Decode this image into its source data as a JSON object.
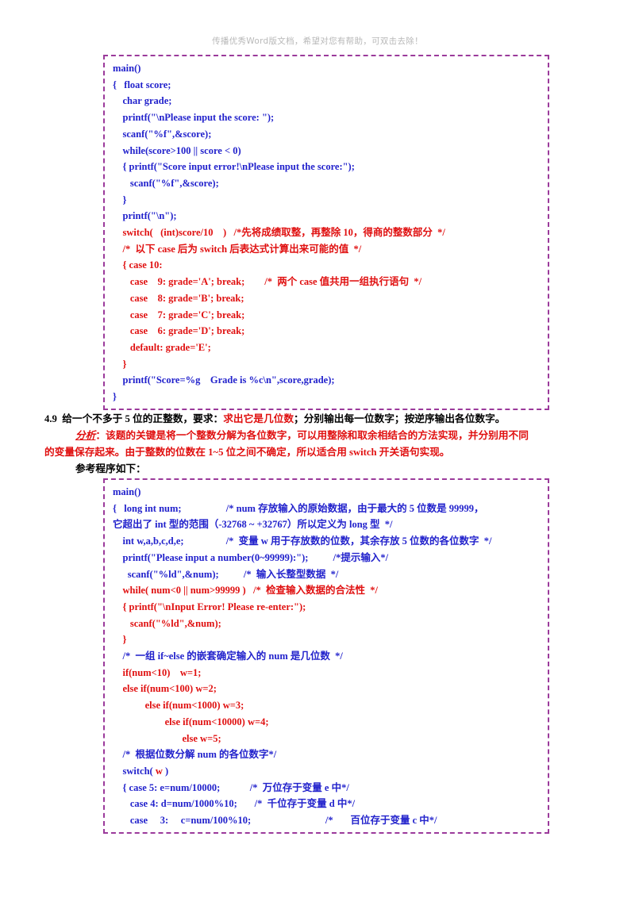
{
  "header": {
    "watermark": "传播优秀Word版文档，希望对您有帮助，可双击去除！"
  },
  "code_block_1": {
    "lines": [
      {
        "text": "main()",
        "color": "blue"
      },
      {
        "text": "{   float score;",
        "color": "blue"
      },
      {
        "text": "    char grade;",
        "color": "blue"
      },
      {
        "text": "    printf(\"\\nPlease input the score: \");",
        "color": "blue"
      },
      {
        "text": "    scanf(\"%f\",&score);",
        "color": "blue"
      },
      {
        "text": "    while(score>100 || score < 0)",
        "color": "blue"
      },
      {
        "text": "    { printf(\"Score input error!\\nPlease input the score:\");",
        "color": "blue"
      },
      {
        "text": "       scanf(\"%f\",&score);",
        "color": "blue"
      },
      {
        "text": "    }",
        "color": "blue"
      },
      {
        "text": "    printf(\"\\n\");",
        "color": "blue"
      },
      {
        "text": "    switch(   (int)score/10    )   /*先将成绩取整，再整除 10，得商的整数部分  */",
        "color": "red"
      },
      {
        "text": "    /*  以下 case 后为 switch 后表达式计算出来可能的值  */",
        "color": "red"
      },
      {
        "text": "    { case 10:",
        "color": "red"
      },
      {
        "text": "       case    9: grade='A'; break;        /*  两个 case 值共用一组执行语句  */",
        "color": "red"
      },
      {
        "text": "       case    8: grade='B'; break;",
        "color": "red"
      },
      {
        "text": "       case    7: grade='C'; break;",
        "color": "red"
      },
      {
        "text": "       case    6: grade='D'; break;",
        "color": "red"
      },
      {
        "text": "       default: grade='E';",
        "color": "red"
      },
      {
        "text": "    }",
        "color": "red"
      },
      {
        "text": "    printf(\"Score=%g    Grade is %c\\n\",score,grade);",
        "color": "blue"
      },
      {
        "text": "}",
        "color": "blue"
      }
    ]
  },
  "problem_49": {
    "number_and_text_black_1": "4.9  给一个不多于 5 位的正整数，要求：",
    "text_red": "求出它是几位数",
    "text_black_2": "；分别输出每一位数字；按逆序输出各位数字。",
    "analysis_label": "分析",
    "analysis_line1": "：该题的关键是将一个整数分解为各位数字，可以用整除和取余相结合的方法实现，并分别用不同",
    "analysis_line2": "的变量保存起来。由于整数的位数在 1~5 位之间不确定，所以适合用 switch 开关语句实现。",
    "reference_label": "参考程序如下："
  },
  "code_block_2": {
    "lines": [
      {
        "text": "main()",
        "color": "blue"
      },
      {
        "text": "{   long int num;                  /* num 存放输入的原始数据，由于最大的 5 位数是 99999，",
        "color": "blue"
      },
      {
        "text": "它超出了 int 型的范围（-32768 ~ +32767）所以定义为 long 型  */",
        "color": "blue"
      },
      {
        "text": "    int w,a,b,c,d,e;                 /*  变量 w 用于存放数的位数，其余存放 5 位数的各位数字  */",
        "color": "blue"
      },
      {
        "text": "    printf(\"Please input a number(0~99999):\");          /*提示输入*/",
        "color": "blue"
      },
      {
        "text": "      scanf(\"%ld\",&num);          /*  输入长整型数据  */",
        "color": "blue"
      },
      {
        "text": "    while( num<0 || num>99999 )   /*  检查输入数据的合法性  */",
        "color": "red"
      },
      {
        "text": "    { printf(\"\\nInput Error! Please re-enter:\");",
        "color": "red"
      },
      {
        "text": "       scanf(\"%ld\",&num);",
        "color": "red"
      },
      {
        "text": "    }",
        "color": "red"
      },
      {
        "text": "    /*  一组 if~else 的嵌套确定输入的 num 是几位数  */",
        "color": "blue"
      },
      {
        "text": "    if(num<10)    w=1;",
        "color": "red"
      },
      {
        "text": "    else if(num<100) w=2;",
        "color": "red"
      },
      {
        "text": "             else if(num<1000) w=3;",
        "color": "red"
      },
      {
        "text": "                     else if(num<10000) w=4;",
        "color": "red"
      },
      {
        "text": "                            else w=5;",
        "color": "red"
      },
      {
        "text": "    /*  根据位数分解 num 的各位数字*/",
        "color": "blue"
      },
      {
        "text": "    switch( w )",
        "color": "blue",
        "segments": [
          {
            "text": "    switch( ",
            "color": "blue"
          },
          {
            "text": "w",
            "color": "red"
          },
          {
            "text": " )",
            "color": "blue"
          }
        ]
      },
      {
        "text": "    { case 5: e=num/10000;            /*  万位存于变量 e 中*/",
        "color": "blue"
      },
      {
        "text": "       case 4: d=num/1000%10;       /*  千位存于变量 d 中*/",
        "color": "blue"
      },
      {
        "text": "       case     3:     c=num/100%10;                              /*       百位存于变量 c 中*/",
        "color": "blue"
      }
    ]
  }
}
